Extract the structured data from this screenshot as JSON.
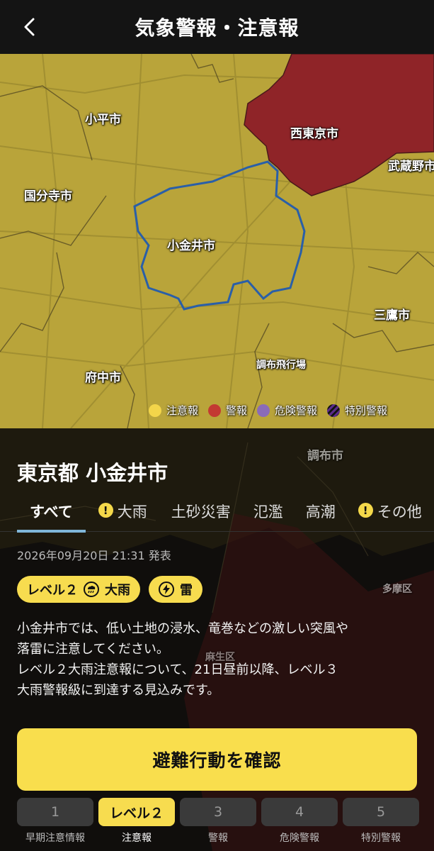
{
  "header": {
    "title": "気象警報・注意報"
  },
  "map": {
    "labels": {
      "kodaira": "小平市",
      "nishitokyo": "西東京市",
      "musashino": "武蔵野市",
      "kokubunji": "国分寺市",
      "koganei": "小金井市",
      "mitaka": "三鷹市",
      "chofu_airport": "調布飛行場",
      "fuchu": "府中市",
      "chofu": "調布市",
      "tama": "多摩区",
      "asao": "麻生区"
    },
    "legend": [
      {
        "label": "注意報",
        "color": "#f3d54a"
      },
      {
        "label": "警報",
        "color": "#c33a32"
      },
      {
        "label": "危険警報",
        "color": "#8a6bb8"
      },
      {
        "label": "特別警報",
        "color": "#5a2a8a"
      }
    ]
  },
  "area": {
    "title": "東京都 小金井市"
  },
  "tabs": [
    {
      "label": "すべて",
      "warn": false
    },
    {
      "label": "大雨",
      "warn": true
    },
    {
      "label": "土砂災害",
      "warn": false
    },
    {
      "label": "氾濫",
      "warn": false
    },
    {
      "label": "高潮",
      "warn": false
    },
    {
      "label": "その他",
      "warn": true
    }
  ],
  "issued": "2026年09月20日 21:31 発表",
  "badges": {
    "heavy_rain_level": "レベル２",
    "heavy_rain": "大雨",
    "thunder": "雷"
  },
  "description": {
    "line1": "小金井市では、低い土地の浸水、竜巻などの激しい突風や",
    "line2": "落雷に注意してください。",
    "line3": "レベル２大雨注意報について、21日昼前以降、レベル３",
    "line4": "大雨警報級に到達する見込みです。"
  },
  "cta": {
    "label": "避難行動を確認"
  },
  "levels": [
    {
      "pill": "1",
      "label": "早期注意情報",
      "active": false
    },
    {
      "pill": "レベル２",
      "label": "注意報",
      "active": true
    },
    {
      "pill": "3",
      "label": "警報",
      "active": false
    },
    {
      "pill": "4",
      "label": "危険警報",
      "active": false
    },
    {
      "pill": "5",
      "label": "特別警報",
      "active": false
    }
  ]
}
